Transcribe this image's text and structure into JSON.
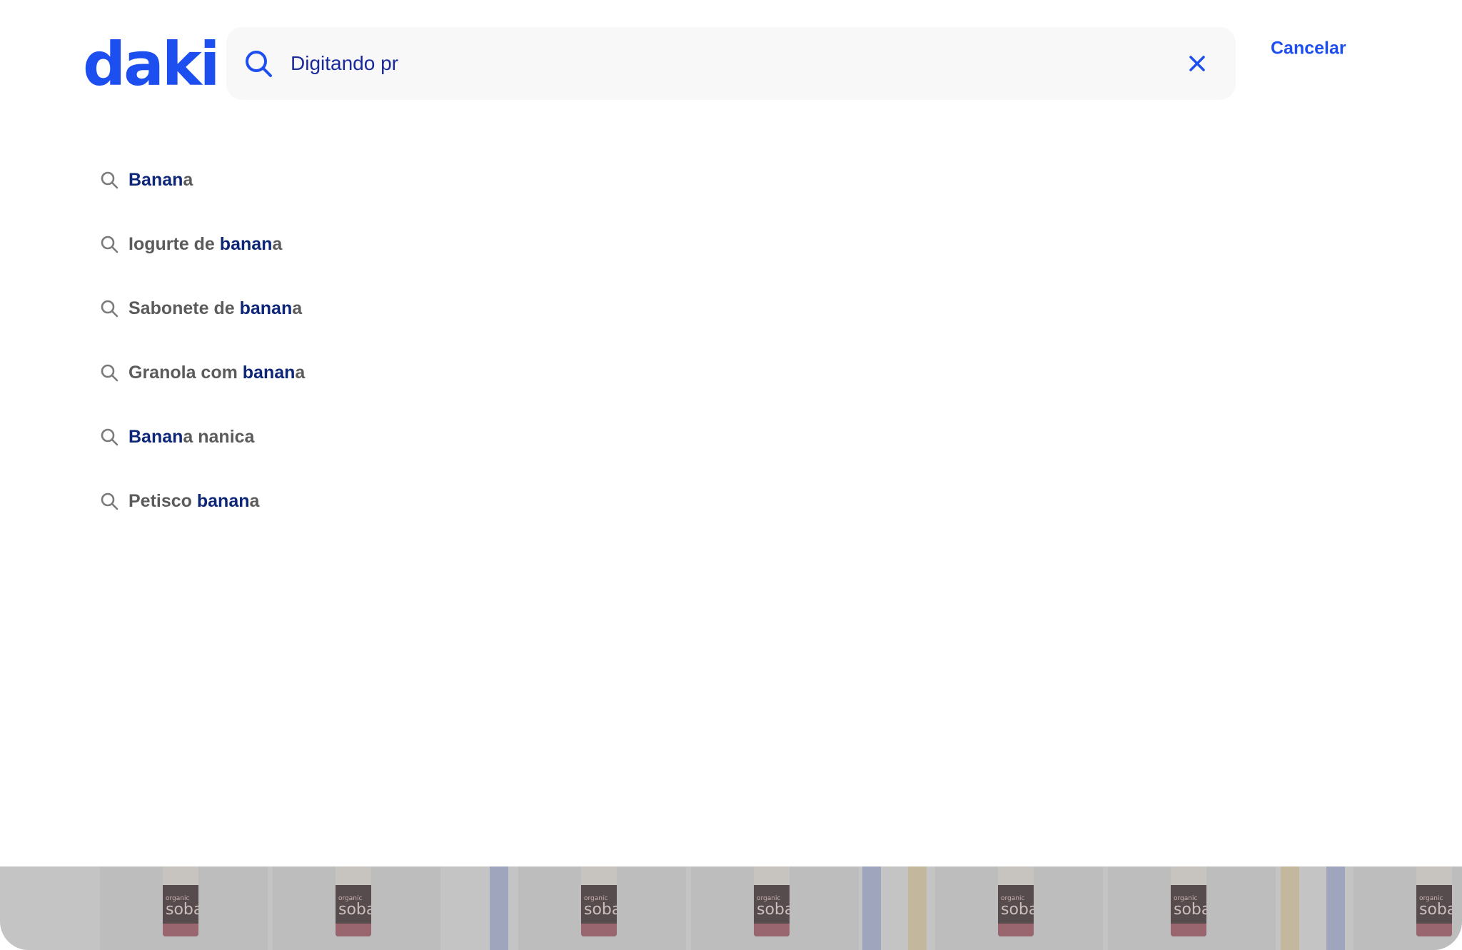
{
  "brand": {
    "logo_text": "daki",
    "color": "#1d4ff0"
  },
  "search": {
    "value": "Digitando pr",
    "placeholder": "",
    "icon": "search-icon",
    "clear_icon": "close-icon",
    "cancel_label": "Cancelar"
  },
  "suggestions": [
    {
      "icon": "search-icon",
      "prefix": "",
      "highlight": "Banan",
      "suffix": "a"
    },
    {
      "icon": "search-icon",
      "prefix": "Iogurte de ",
      "highlight": "banan",
      "suffix": "a"
    },
    {
      "icon": "search-icon",
      "prefix": "Sabonete de ",
      "highlight": "banan",
      "suffix": "a"
    },
    {
      "icon": "search-icon",
      "prefix": "Granola com ",
      "highlight": "banan",
      "suffix": "a"
    },
    {
      "icon": "search-icon",
      "prefix": "",
      "highlight": "Banan",
      "suffix": "a nanica"
    },
    {
      "icon": "search-icon",
      "prefix": "Petisco ",
      "highlight": "banan",
      "suffix": "a"
    }
  ],
  "background_products": {
    "label_small": "organic",
    "label_large": "soba"
  },
  "colors": {
    "accent": "#1d4ff0",
    "input_text": "#1a2a9c",
    "suggestion_text": "#5b5b5b",
    "suggestion_highlight": "#0d2678",
    "search_bg": "#f8f8f8"
  }
}
